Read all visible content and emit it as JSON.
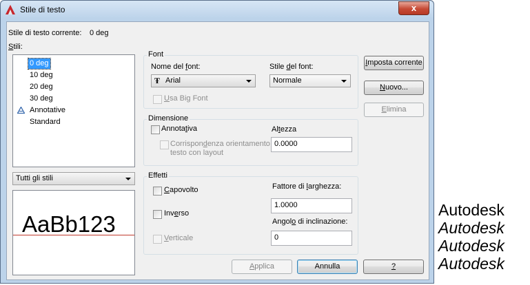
{
  "window": {
    "title": "Stile di testo",
    "close_symbol": "x"
  },
  "current_style": {
    "label": "Stile di testo corrente:",
    "value": "0 deg"
  },
  "styles": {
    "label_u": "S",
    "label_rest": "tili:",
    "items": [
      "0 deg",
      "10 deg",
      "20 deg",
      "30 deg",
      "Annotative",
      "Standard"
    ],
    "selected_index": 0,
    "filter_value": "Tutti gli stili"
  },
  "preview": {
    "text": "AaBb123"
  },
  "font": {
    "title": "Font",
    "name_label_pre": "Nome del ",
    "name_label_u": "f",
    "name_label_post": "ont:",
    "name_value": "Arial",
    "style_label_pre": "Stile ",
    "style_label_u": "d",
    "style_label_post": "el font:",
    "style_value": "Normale",
    "bigfont_label_u": "U",
    "bigfont_label_rest": "sa Big Font"
  },
  "size": {
    "title": "Dimensione",
    "annotative_pre": "Annota",
    "annotative_u": "t",
    "annotative_post": "iva",
    "match_pre": "Corrispon",
    "match_u": "d",
    "match_post": "enza orientamento",
    "match_line2": "testo con layout",
    "height_pre": "Al",
    "height_u": "t",
    "height_post": "ezza",
    "height_value": "0.0000"
  },
  "effects": {
    "title": "Effetti",
    "upside_u": "C",
    "upside_rest": "apovolto",
    "backwards_pre": "Inv",
    "backwards_u": "e",
    "backwards_post": "rso",
    "vertical_u": "V",
    "vertical_rest": "erticale",
    "width_pre": "Fattore di ",
    "width_u": "l",
    "width_post": "arghezza:",
    "width_value": "1.0000",
    "oblique_pre": "Angol",
    "oblique_u": "o",
    "oblique_post": " di inclinazione:",
    "oblique_value": "0"
  },
  "buttons": {
    "set_current_u": "I",
    "set_current_rest": "mposta corrente",
    "new_u": "N",
    "new_rest": "uovo...",
    "delete_u": "E",
    "delete_rest": "limina",
    "apply_u": "A",
    "apply_rest": "pplica",
    "cancel": "Annulla",
    "help_u": "?"
  },
  "side_samples": [
    "Autodesk",
    "Autodesk",
    "Autodesk",
    "Autodesk"
  ]
}
